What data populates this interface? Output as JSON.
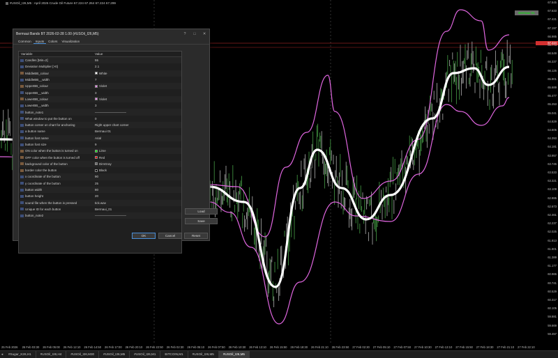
{
  "window": {
    "title": "#USOil_I26,M5 : April 2026 Crude Oil Future  67.224 67.264 67.224 67.299"
  },
  "ea_button": {
    "label": "Bermaui 01"
  },
  "bid_price": "67.224",
  "price_ticks": [
    "67.845",
    "67.633",
    "67.421",
    "67.197",
    "66.985",
    "66.773",
    "66.549",
    "66.337",
    "66.125",
    "65.901",
    "65.689",
    "65.477",
    "65.253",
    "65.041",
    "64.829",
    "64.605",
    "64.393",
    "64.181",
    "63.957",
    "63.745",
    "63.533",
    "63.321",
    "63.109",
    "62.885",
    "62.673",
    "62.461",
    "62.237",
    "62.025",
    "61.813",
    "61.601",
    "61.389",
    "61.177",
    "60.965",
    "60.741",
    "60.529",
    "60.317",
    "60.105",
    "59.881",
    "59.669",
    "59.457",
    "59.233",
    "59.021",
    "58.809",
    "58.597",
    "58.385",
    "58.161",
    "57.949",
    "57.737",
    "57.525",
    "57.313",
    "57.101",
    "56.877",
    "56.665",
    "56.453",
    "56.241",
    "56.029",
    "55.817",
    "55.605",
    "55.393",
    "55.181",
    "54.969",
    "54.757",
    "54.545",
    "54.333",
    "54.121",
    "53.909",
    "53.697",
    "53.485",
    "53.273",
    "53.061",
    "52.849",
    "52.637",
    "52.425",
    "52.213",
    "52.001",
    "51.789",
    "51.577",
    "51.365",
    "51.153",
    "50.941",
    "50.729",
    "50.517"
  ],
  "time_ticks": [
    "25 Feb 2026",
    "26 Feb 03:30",
    "26 Feb 05:00",
    "26 Feb 12:10",
    "26 Feb 14:50",
    "26 Feb 17:00",
    "26 Feb 20:10",
    "26 Feb 22:50",
    "26 Feb 02:30",
    "26 Feb 05:10",
    "26 Feb 07:50",
    "26 Feb 10:30",
    "26 Feb 13:10",
    "26 Feb 15:50",
    "26 Feb 18:30",
    "26 Feb 21:10",
    "26 Feb 23:50",
    "27 Feb 02:30",
    "27 Feb 05:10",
    "27 Feb 07:50",
    "27 Feb 10:30",
    "27 Feb 13:10",
    "27 Feb 15:50",
    "27 Feb 18:30",
    "27 Feb 21:10",
    "27 Feb 22:10"
  ],
  "tabs": [
    "#Sugar_K26,H1",
    "#USOil_I26,H4",
    "#USOil_I26,M30",
    "#USOil_I26,M5",
    "#USOil_I26,M1",
    "BITCOIN,M1",
    "#USOil_I26,M5",
    "#USOil_I26,M5"
  ],
  "active_tab": 7,
  "dialog": {
    "title": "Bermaui Bands BT 2026-02-28 1.00 (#USOil_I26,M5)",
    "tabs": [
      "Common",
      "Inputs",
      "Colors",
      "Visualization"
    ],
    "active_tab": 1,
    "col_variable": "Variable",
    "col_value": "Value",
    "params": [
      {
        "name": "Candles [Min=2]",
        "value": "55",
        "color": ""
      },
      {
        "name": "Deviation Multiplier [>0]",
        "value": "2.1",
        "color": ""
      },
      {
        "name": "MiddleBB_colour",
        "value": "White",
        "color": "#ffffff"
      },
      {
        "name": "MiddleBB__width",
        "value": "7",
        "color": ""
      },
      {
        "name": "UpperBB_colour",
        "value": "Violet",
        "color": "#ee82ee"
      },
      {
        "name": "UpperBB__width",
        "value": "3",
        "color": ""
      },
      {
        "name": "LowerBB_colour",
        "value": "Violet",
        "color": "#ee82ee"
      },
      {
        "name": "LowerBB__width",
        "value": "3",
        "color": ""
      },
      {
        "name": "button_note1",
        "value": "——————————",
        "color": ""
      },
      {
        "name": "What window to put the button on",
        "value": "0",
        "color": ""
      },
      {
        "name": "button corner on chart for anchoring",
        "value": "Right upper chart corner",
        "color": ""
      },
      {
        "name": "a button name",
        "value": "Bermaui 01",
        "color": ""
      },
      {
        "name": "button font name",
        "value": "Arial",
        "color": ""
      },
      {
        "name": "button font size",
        "value": "9",
        "color": ""
      },
      {
        "name": "ON color when the button is turned on",
        "value": "Lime",
        "color": "#00ff00"
      },
      {
        "name": "OFF color when the button is turned off",
        "value": "Red",
        "color": "#ff0000"
      },
      {
        "name": "background color of the button",
        "value": "DimGray",
        "color": "#696969"
      },
      {
        "name": "border color the button",
        "value": "Black",
        "color": "#000000"
      },
      {
        "name": "x coordinate of the button",
        "value": "90",
        "color": ""
      },
      {
        "name": "y coordinate of the button",
        "value": "25",
        "color": ""
      },
      {
        "name": "button width",
        "value": "80",
        "color": ""
      },
      {
        "name": "button height",
        "value": "20",
        "color": ""
      },
      {
        "name": "sound file when the button is pressed",
        "value": "tick.wav",
        "color": ""
      },
      {
        "name": "Unique ID for each button",
        "value": "Bermaui_01",
        "color": ""
      },
      {
        "name": "button_note2",
        "value": "——————————",
        "color": ""
      }
    ],
    "load_label": "Load",
    "save_label": "Save",
    "ok_label": "OK",
    "cancel_label": "Cancel",
    "reset_label": "Reset"
  }
}
